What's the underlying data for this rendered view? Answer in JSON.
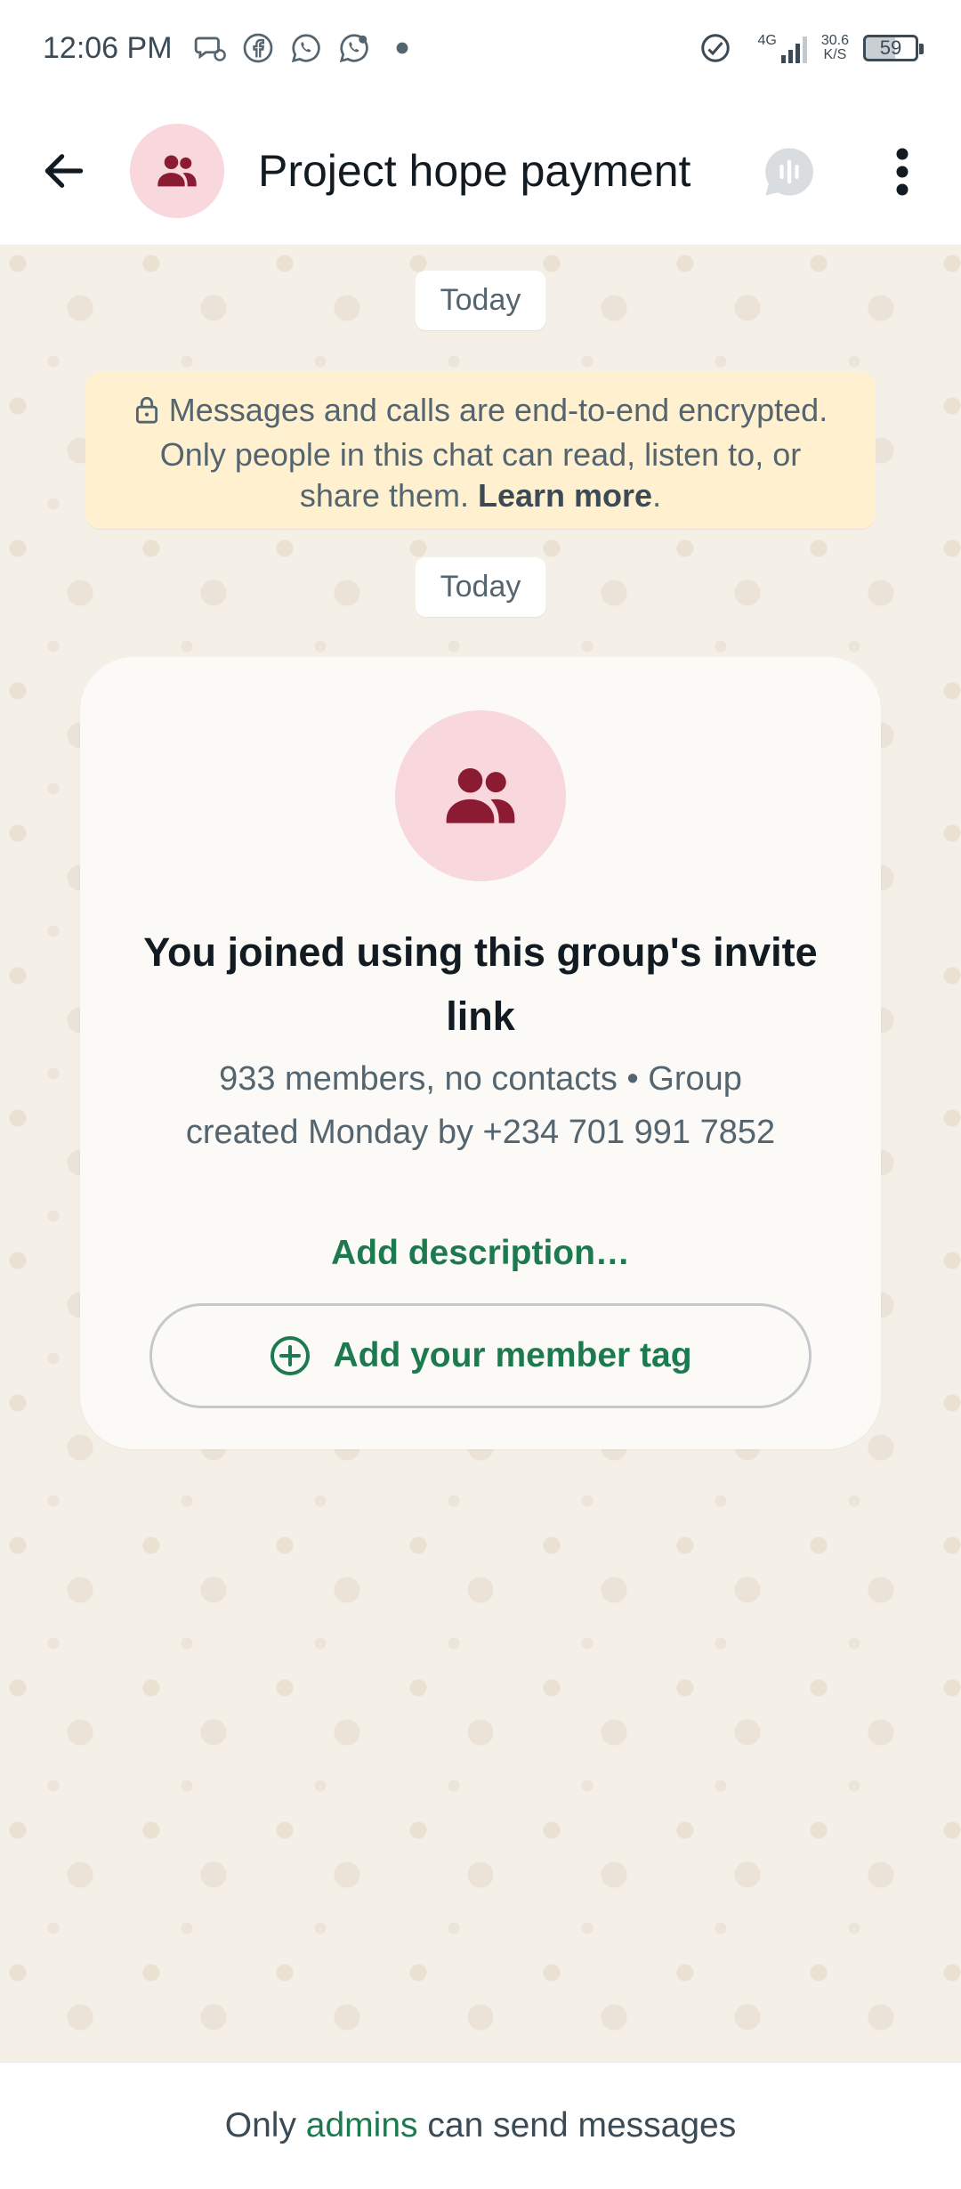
{
  "status_bar": {
    "time": "12:06 PM",
    "left_icons": [
      "message-icon",
      "facebook-icon",
      "whatsapp-icon",
      "whatsapp-business-icon",
      "dot-icon"
    ],
    "network": "4G",
    "speed_value": "30.6",
    "speed_unit": "K/S",
    "battery": "59"
  },
  "header": {
    "title": "Project hope payment",
    "back_icon": "arrow-left-icon",
    "avatar_icon": "group-icon",
    "call_icon": "voice-chat-icon",
    "menu_icon": "more-vertical-icon"
  },
  "chat": {
    "date_chip_1": "Today",
    "date_chip_2": "Today",
    "encryption": {
      "text": "Messages and calls are end-to-end encrypted. Only people in this chat can read, listen to, or share them.",
      "link": "Learn more",
      "suffix": "."
    },
    "group_card": {
      "heading": "You joined using this group's invite link",
      "meta": "933 members, no contacts • Group created Monday by +234 701 991 7852",
      "add_description": "Add description…",
      "member_tag_button": "Add your member tag"
    }
  },
  "footer": {
    "prefix": "Only",
    "link": "admins",
    "suffix": "can send messages"
  },
  "colors": {
    "accent_green": "#1d7a4f",
    "avatar_bg": "#f8d7dd",
    "avatar_icon": "#8b1a33",
    "chat_bg": "#f4efe7",
    "banner_bg": "#fff1cf"
  }
}
